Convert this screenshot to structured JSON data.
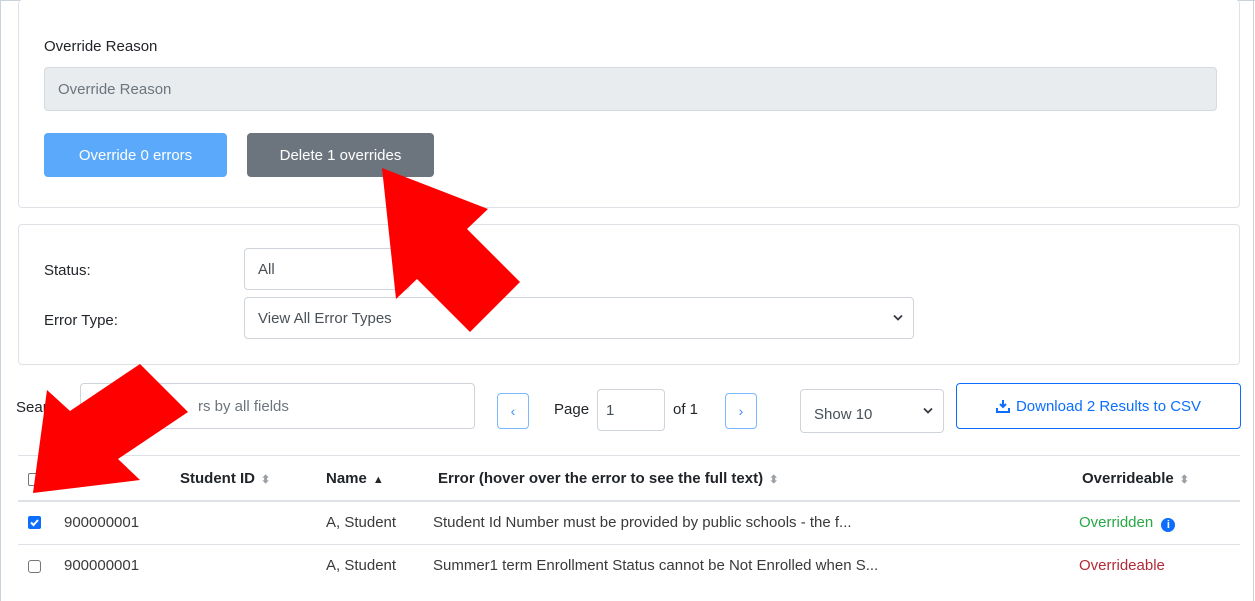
{
  "override_card": {
    "reason_label": "Override Reason",
    "reason_placeholder": "Override Reason",
    "override_button": "Override 0 errors",
    "delete_button": "Delete 1 overrides"
  },
  "filters": {
    "status_label": "Status:",
    "status_value": "All",
    "error_type_label": "Error Type:",
    "error_type_value": "View All Error Types"
  },
  "toolbar": {
    "search_label": "Search",
    "search_placeholder": "rs by all fields",
    "prev_icon": "‹",
    "page_label": "Page",
    "page_value": "1",
    "of_label": "of 1",
    "next_icon": "›",
    "show_value": "Show 10",
    "download_label": "Download 2 Results to CSV"
  },
  "table": {
    "columns": {
      "student_id": "Student ID",
      "name": "Name",
      "error": "Error (hover over the error to see the full text)",
      "overrideable": "Overrideable"
    },
    "rows": [
      {
        "checked": true,
        "student_id": "900000001",
        "name": "A, Student",
        "error": "Student Id Number must be provided by public schools - the f...",
        "status": "Overridden",
        "status_color": "#28a745"
      },
      {
        "checked": false,
        "student_id": "900000001",
        "name": "A, Student",
        "error": "Summer1 term Enrollment Status cannot be Not Enrolled when S...",
        "status": "Overrideable",
        "status_color": "#b02a37"
      }
    ]
  },
  "colors": {
    "primary_light": "#5aa9fb",
    "secondary": "#6c757d",
    "annotation_red": "#ff0000"
  }
}
